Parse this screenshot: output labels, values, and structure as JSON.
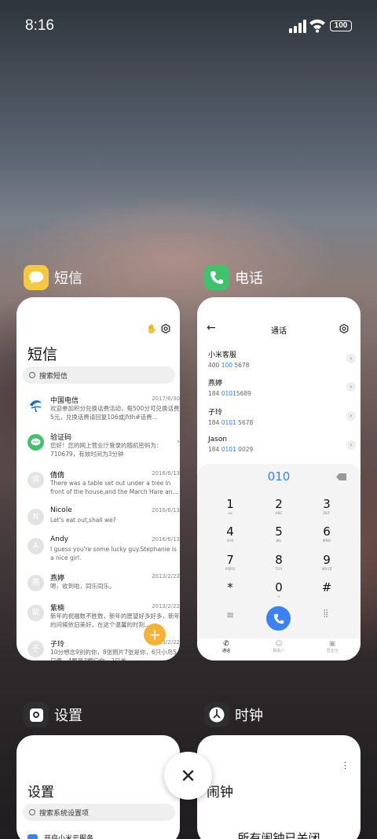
{
  "status": {
    "time": "8:16",
    "battery": "100"
  },
  "apps": {
    "sms": {
      "name": "短信",
      "title": "短信",
      "search_placeholder": "搜索短信",
      "messages": [
        {
          "name": "中国电信",
          "date": "2017/6/30",
          "body": "欢迎参加积分兑换话费活动，每500分可兑换话费5元，兑换话费请回复106或jfdh#话费...",
          "avatar": ""
        },
        {
          "name": "验证码",
          "date": "",
          "body": "您好！您的网上营业厅登录的随机密码为：710679，有效时间为3分钟",
          "avatar": ""
        },
        {
          "name": "倩倩",
          "date": "2016/6/13",
          "body": "There was a table set out under a tree in front of the house,and the March Hare an...",
          "avatar": "倩"
        },
        {
          "name": "Nicole",
          "date": "2016/6/13",
          "body": "Let's eat out,shall we?",
          "avatar": "N"
        },
        {
          "name": "Andy",
          "date": "2016/6/13",
          "body": "I guess you're some lucky guy.Stephanie is a nice girl.",
          "avatar": "A"
        },
        {
          "name": "燕婷",
          "date": "2013/2/22",
          "body": "嗯，收到啦，同乐同乐。",
          "avatar": "燕"
        },
        {
          "name": "紫楠",
          "date": "2013/2/22",
          "body": "新年的祝福数不胜数，新年的愿望好多好多，新年的问候依旧美好，在这个温馨的时刻...",
          "avatar": "紫"
        },
        {
          "name": "子玲",
          "date": "2013/2/22",
          "body": "10分想念9别的你，8张照片7张是你，6只小鸟5只傻，4颗星3颗归你，2只羊…",
          "avatar": "子"
        }
      ],
      "fab": "+"
    },
    "phone": {
      "name": "电话",
      "title": "通话",
      "contacts": [
        {
          "name": "小米客服",
          "pre": "400 ",
          "hl": "100",
          "post": " 5678"
        },
        {
          "name": "燕婷",
          "pre": "184 ",
          "hl": "0101",
          "post": "5689"
        },
        {
          "name": "子玲",
          "pre": "184 ",
          "hl": "0101",
          "post": " 5678"
        },
        {
          "name": "Jason",
          "pre": "184 ",
          "hl": "0101",
          "post": " 0029"
        }
      ],
      "dialed": "010",
      "keys": [
        {
          "n": "1",
          "l": "oo"
        },
        {
          "n": "2",
          "l": "ABC"
        },
        {
          "n": "3",
          "l": "DEF"
        },
        {
          "n": "4",
          "l": "GHI"
        },
        {
          "n": "5",
          "l": "JKL"
        },
        {
          "n": "6",
          "l": "MNO"
        },
        {
          "n": "7",
          "l": "PQRS"
        },
        {
          "n": "8",
          "l": "TUV"
        },
        {
          "n": "9",
          "l": "WXYZ"
        },
        {
          "n": "*",
          "l": ""
        },
        {
          "n": "0",
          "l": "+"
        },
        {
          "n": "#",
          "l": ""
        }
      ],
      "tabs": [
        "通话",
        "联系人",
        "营业厅"
      ]
    },
    "settings": {
      "name": "设置",
      "title": "设置",
      "search_placeholder": "搜索系统设置项",
      "first_item": "开启小米云服务"
    },
    "clock": {
      "name": "时钟",
      "title": "闹钟",
      "empty": "所有闹钟已关闭"
    }
  },
  "colors": {
    "sms_icon": "#f5c842",
    "phone_icon": "#3fc26b",
    "fab": "#f5b236",
    "accent": "#3b82f6"
  }
}
